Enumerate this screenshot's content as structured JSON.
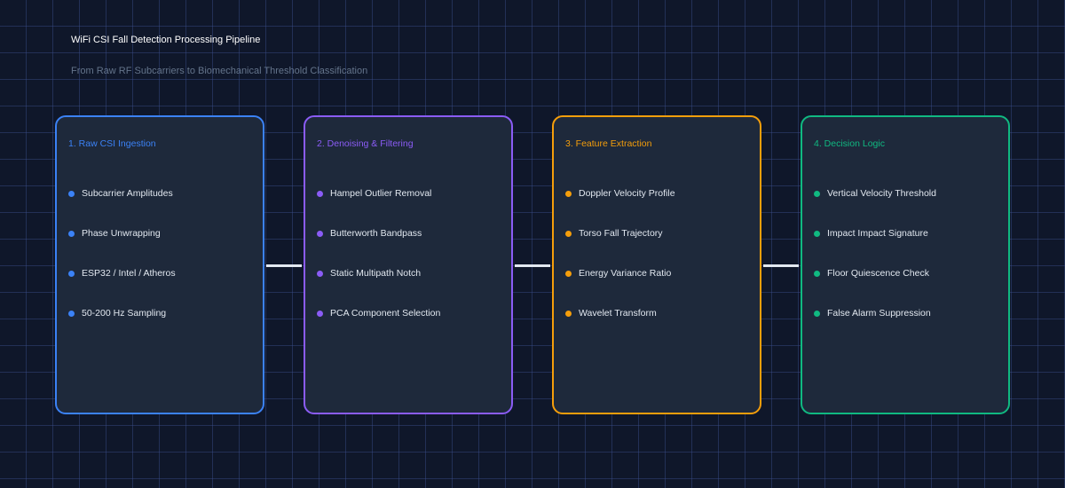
{
  "header": {
    "title": "WiFi CSI Fall Detection Processing Pipeline",
    "subtitle": "From Raw RF Subcarriers to Biomechanical Threshold Classification"
  },
  "stages": [
    {
      "title": "1. Raw CSI Ingestion",
      "color": "#3b82f6",
      "items": [
        "Subcarrier Amplitudes",
        "Phase Unwrapping",
        "ESP32 / Intel / Atheros",
        "50-200 Hz Sampling"
      ]
    },
    {
      "title": "2. Denoising & Filtering",
      "color": "#8b5cf6",
      "items": [
        "Hampel Outlier Removal",
        "Butterworth Bandpass",
        "Static Multipath Notch",
        "PCA Component Selection"
      ]
    },
    {
      "title": "3. Feature Extraction",
      "color": "#f59e0b",
      "items": [
        "Doppler Velocity Profile",
        "Torso Fall Trajectory",
        "Energy Variance Ratio",
        "Wavelet Transform"
      ]
    },
    {
      "title": "4. Decision Logic",
      "color": "#10b981",
      "items": [
        "Vertical Velocity Threshold",
        "Impact Impact Signature",
        "Floor Quiescence Check",
        "False Alarm Suppression"
      ]
    }
  ],
  "connector_color": "#e2e8f0"
}
